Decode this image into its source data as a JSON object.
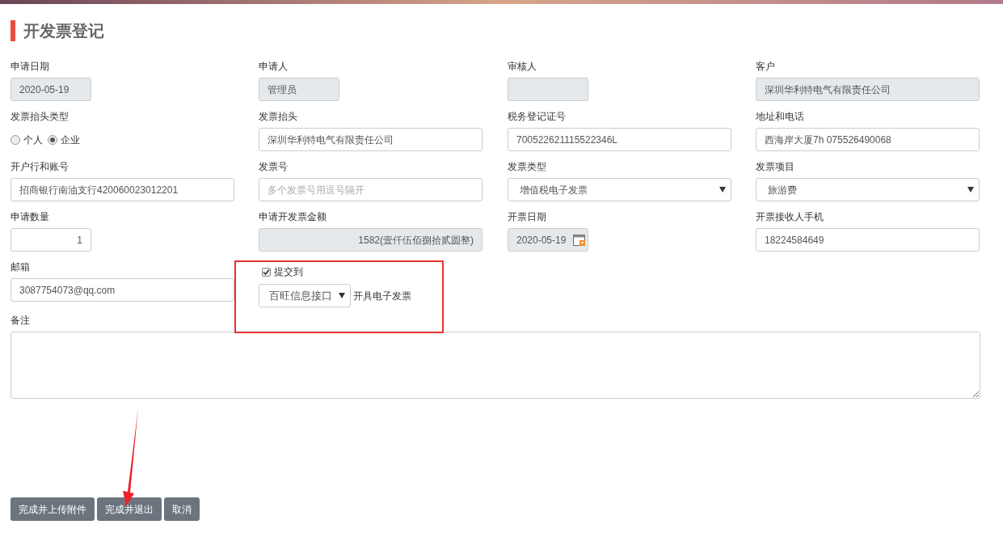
{
  "title": "开发票登记",
  "fields": [
    {
      "label": "申请日期",
      "kind": "text",
      "short": true,
      "disabled": true,
      "value": "2020-05-19"
    },
    {
      "label": "申请人",
      "kind": "text",
      "short": true,
      "disabled": true,
      "value": "管理员"
    },
    {
      "label": "审核人",
      "kind": "text",
      "short": true,
      "disabled": true
    },
    {
      "label": "客户",
      "kind": "text",
      "short": false,
      "disabled": true,
      "value": "深圳华利特电气有限责任公司"
    },
    {
      "label": "发票抬头类型",
      "kind": "radio",
      "options": [
        {
          "label": "个人",
          "selected": false
        },
        {
          "label": "企业",
          "selected": true
        }
      ]
    },
    {
      "label": "发票抬头",
      "kind": "text",
      "short": false,
      "disabled": false,
      "value": "深圳华利特电气有限责任公司"
    },
    {
      "label": "税务登记证号",
      "kind": "text",
      "short": false,
      "disabled": false,
      "value": "700522621115522346L"
    },
    {
      "label": "地址和电话",
      "kind": "text",
      "short": false,
      "disabled": false,
      "value": "西海岸大厦7h 075526490068"
    },
    {
      "label": "开户行和账号",
      "kind": "text",
      "short": false,
      "disabled": false,
      "value": "招商银行南油支行420060023012201"
    },
    {
      "label": "发票号",
      "kind": "text",
      "short": false,
      "disabled": false,
      "placeholder": "多个发票号用逗号隔开"
    },
    {
      "label": "发票类型",
      "kind": "select",
      "value": "增值税电子发票"
    },
    {
      "label": "发票项目",
      "kind": "select",
      "value": "旅游费"
    },
    {
      "label": "申请数量",
      "kind": "number",
      "short": true,
      "disabled": false,
      "value": "1"
    },
    {
      "label": "申请开发票金额",
      "kind": "number",
      "short": false,
      "disabled": true,
      "value": "1582(壹仟伍佰捌拾贰圆整)"
    },
    {
      "label": "开票日期",
      "kind": "date",
      "disabled": true,
      "value": "2020-05-19"
    },
    {
      "label": "开票接收人手机",
      "kind": "text",
      "short": false,
      "disabled": false,
      "value": "18224584649"
    },
    {
      "label": "邮箱",
      "kind": "text",
      "short": false,
      "disabled": false,
      "value": "3087754073@qq.com"
    },
    {
      "kind": "submit",
      "checkbox_label": "提交到",
      "checked": true,
      "select_value": "百旺信息接口",
      "suffix": "开具电子发票"
    }
  ],
  "remarks": {
    "label": "备注"
  },
  "buttons": [
    "完成并上传附件",
    "完成并退出",
    "取消"
  ]
}
